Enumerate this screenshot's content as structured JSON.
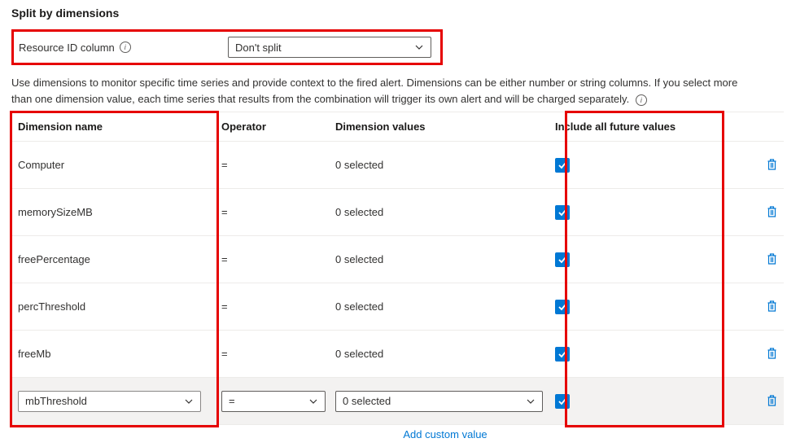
{
  "section": {
    "title": "Split by dimensions",
    "resource_label": "Resource ID column",
    "resource_value": "Don't split",
    "description_line1": "Use dimensions to monitor specific time series and provide context to the fired alert. Dimensions can be either number or string columns. If you select more",
    "description_line2": "than one dimension value, each time series that results from the combination will trigger its own alert and will be charged separately."
  },
  "table": {
    "headers": {
      "dimension_name": "Dimension name",
      "operator": "Operator",
      "dimension_values": "Dimension values",
      "include_future": "Include all future values"
    },
    "rows": [
      {
        "name": "Computer",
        "operator": "=",
        "values": "0 selected",
        "include_future": true
      },
      {
        "name": "memorySizeMB",
        "operator": "=",
        "values": "0 selected",
        "include_future": true
      },
      {
        "name": "freePercentage",
        "operator": "=",
        "values": "0 selected",
        "include_future": true
      },
      {
        "name": "percThreshold",
        "operator": "=",
        "values": "0 selected",
        "include_future": true
      },
      {
        "name": "freeMb",
        "operator": "=",
        "values": "0 selected",
        "include_future": true
      },
      {
        "name": "mbThreshold",
        "operator": "=",
        "values": "0 selected",
        "include_future": true,
        "active": true
      }
    ],
    "add_custom_label": "Add custom value"
  }
}
